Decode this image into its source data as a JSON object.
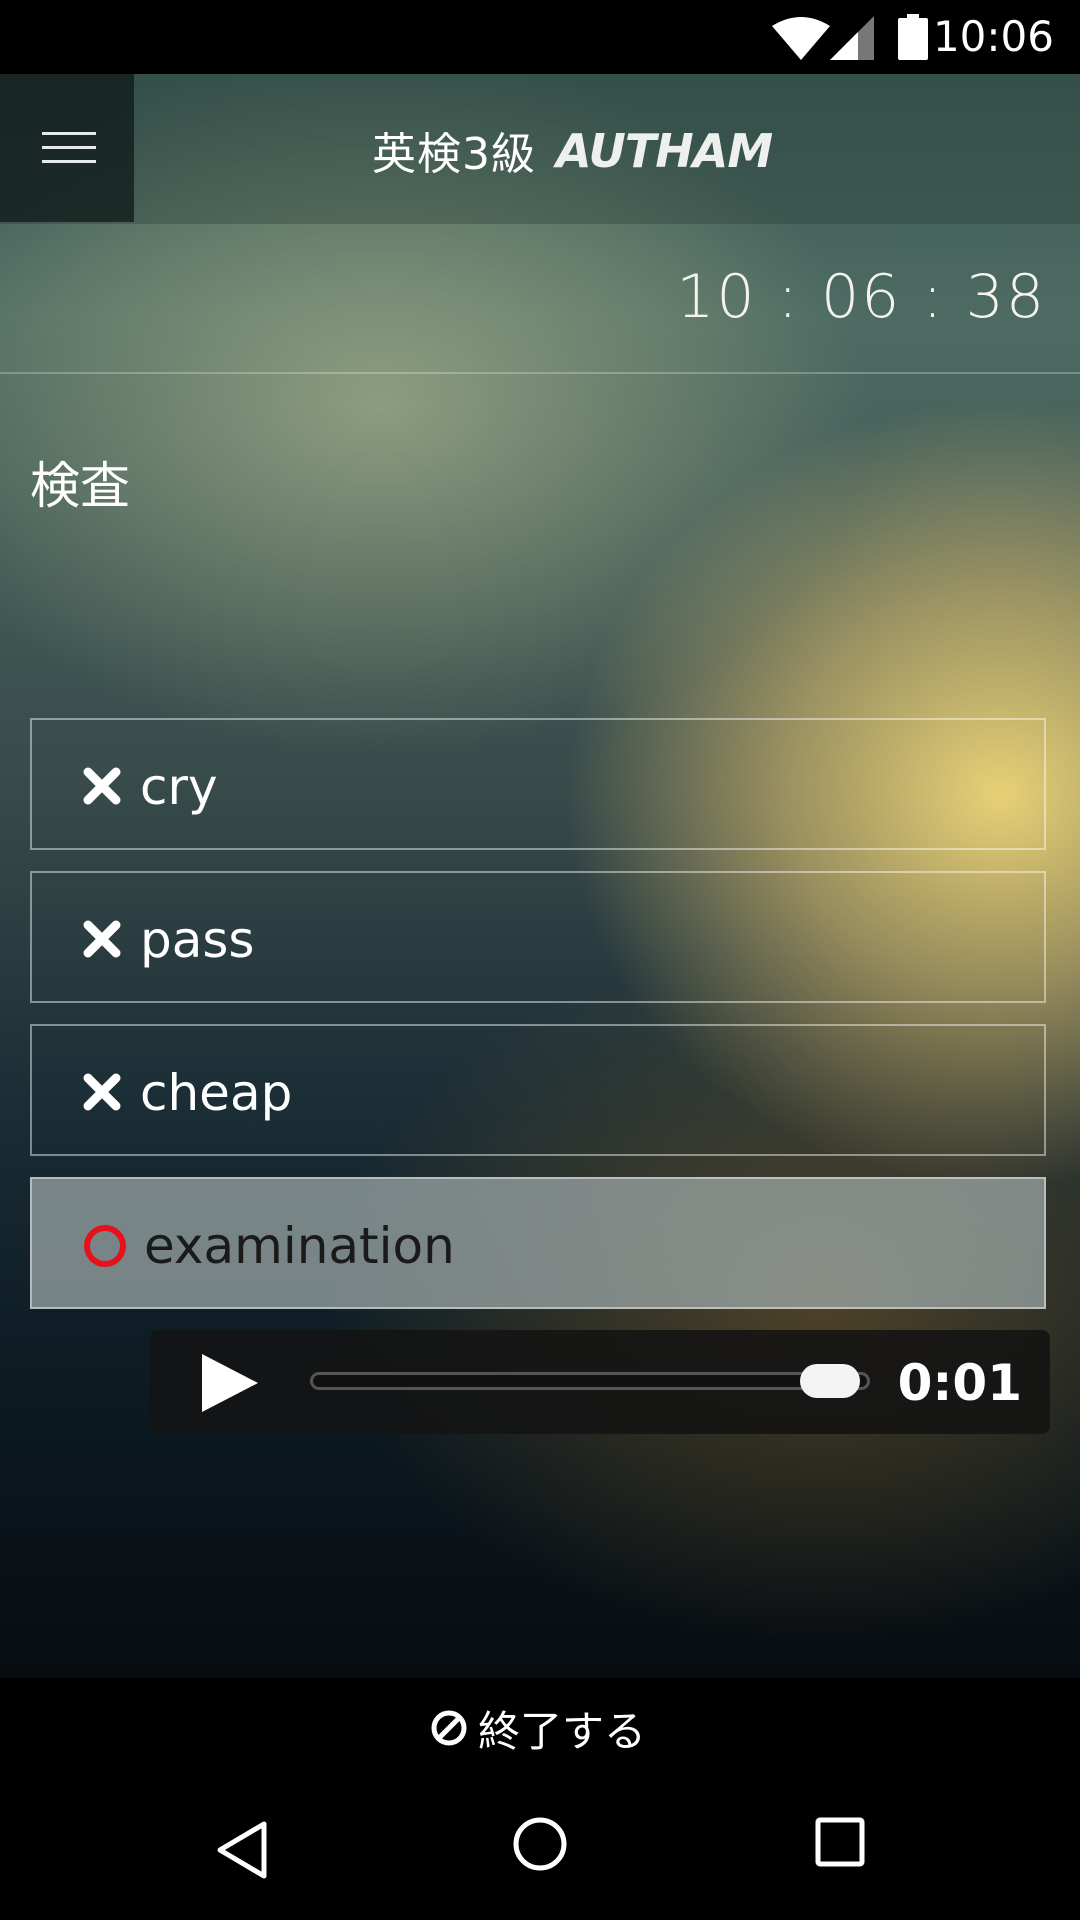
{
  "status_bar": {
    "time": "10:06",
    "icons": [
      "wifi-icon",
      "signal-icon",
      "battery-icon"
    ]
  },
  "header": {
    "title": "英検3級",
    "logo": "AUTHAM",
    "menu_icon": "hamburger-menu-icon"
  },
  "clock": "10 : 06 : 38",
  "question": "検査",
  "options": [
    {
      "label": "cry",
      "result": "wrong",
      "icon": "cross-icon"
    },
    {
      "label": "pass",
      "result": "wrong",
      "icon": "cross-icon"
    },
    {
      "label": "cheap",
      "result": "wrong",
      "icon": "cross-icon"
    },
    {
      "label": "examination",
      "result": "correct",
      "icon": "circle-icon"
    }
  ],
  "player": {
    "time": "0:01",
    "progress": 0.98
  },
  "footer": {
    "quit_label": "終了する"
  },
  "colors": {
    "correct_mark": "#e8101a",
    "wrong_mark": "#ffffff"
  }
}
